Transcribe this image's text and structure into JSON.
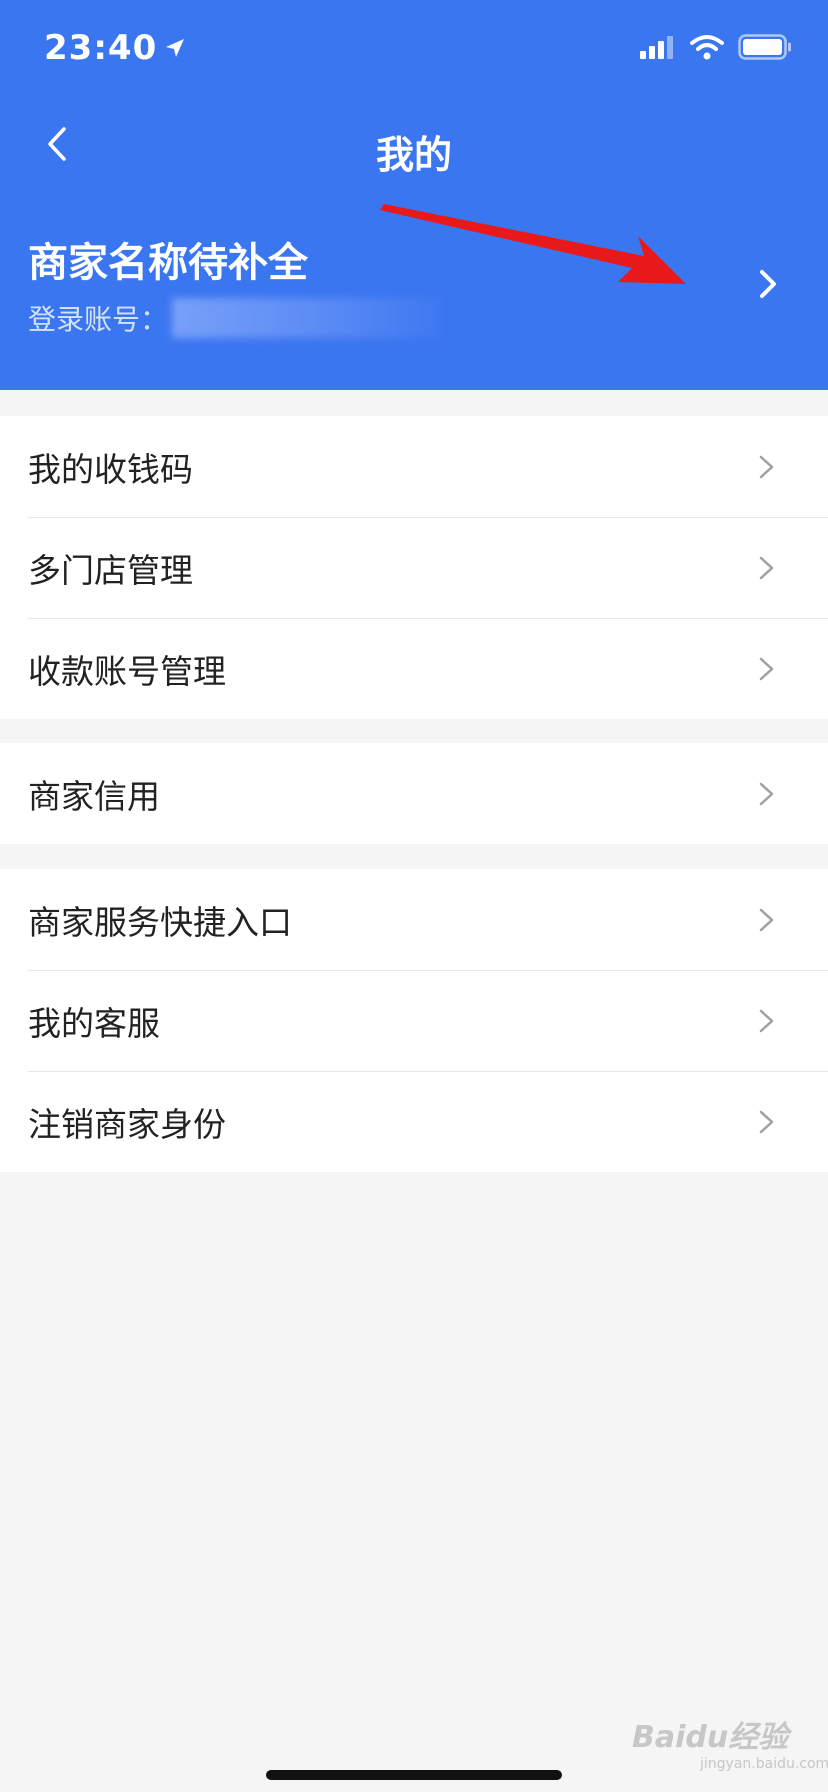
{
  "status_bar": {
    "time": "23:40",
    "icons": [
      "location-arrow-icon",
      "signal-icon",
      "wifi-icon",
      "battery-icon"
    ]
  },
  "nav": {
    "title": "我的",
    "back_icon": "chevron-left-icon"
  },
  "merchant": {
    "name": "商家名称待补全",
    "account_label": "登录账号：",
    "chevron_icon": "chevron-right-icon"
  },
  "groups": [
    {
      "items": [
        {
          "label": "我的收钱码"
        },
        {
          "label": "多门店管理"
        },
        {
          "label": "收款账号管理"
        }
      ]
    },
    {
      "items": [
        {
          "label": "商家信用"
        }
      ]
    },
    {
      "items": [
        {
          "label": "商家服务快捷入口"
        },
        {
          "label": "我的客服"
        },
        {
          "label": "注销商家身份"
        }
      ]
    }
  ],
  "watermark": {
    "text": "Baidu经验",
    "sub": "jingyan.baidu.com"
  },
  "colors": {
    "header_bg": "#3b76f1",
    "page_bg": "#f5f5f5",
    "annotation_arrow": "#e8191b"
  }
}
